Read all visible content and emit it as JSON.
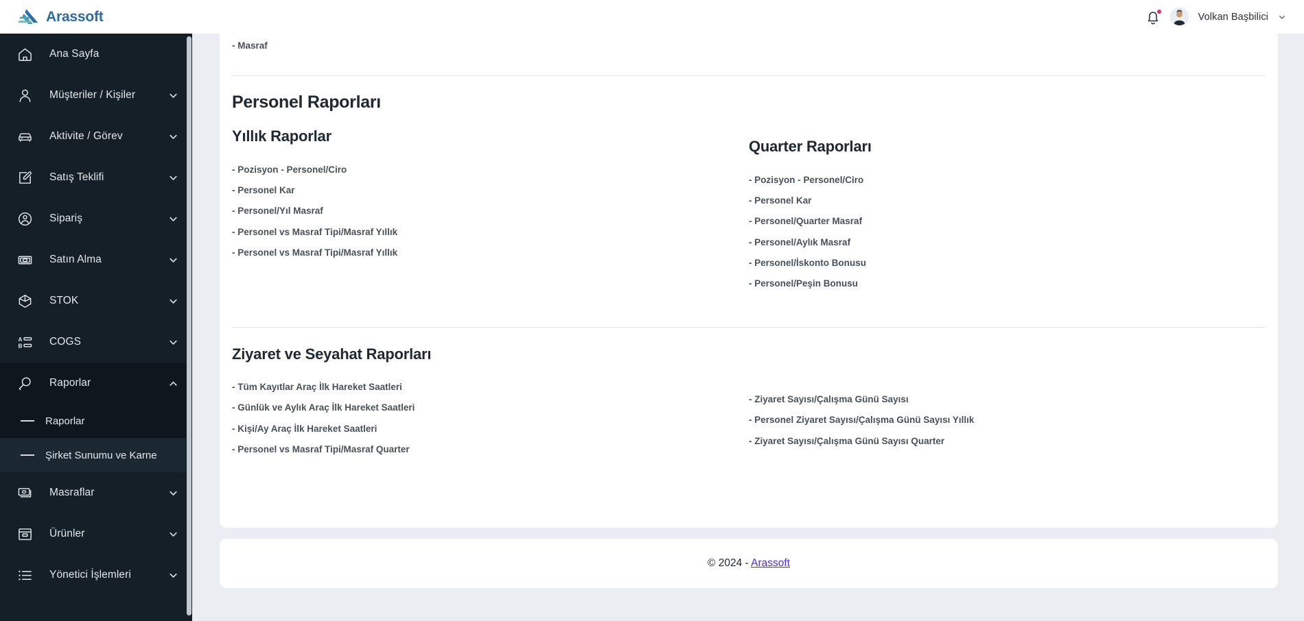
{
  "brand": {
    "name": "Arassoft",
    "logo_icon": "arassoft-logo-icon"
  },
  "header": {
    "notification_icon": "bell-icon",
    "has_notification_dot": true,
    "avatar_icon": "user-avatar",
    "user_name": "Volkan Başbilici",
    "chevron_icon": "chevron-down-icon"
  },
  "sidebar": {
    "items": [
      {
        "label": "Ana Sayfa",
        "icon": "home-icon",
        "expandable": false
      },
      {
        "label": "Müşteriler / Kişiler",
        "icon": "person-icon",
        "expandable": true,
        "chevron": "chevron-down-icon"
      },
      {
        "label": "Aktivite / Görev",
        "icon": "car-icon",
        "expandable": true,
        "chevron": "chevron-down-icon"
      },
      {
        "label": "Satış Teklifi",
        "icon": "edit-document-icon",
        "expandable": true,
        "chevron": "chevron-down-icon"
      },
      {
        "label": "Sipariş",
        "icon": "user-circle-icon",
        "expandable": true,
        "chevron": "chevron-down-icon"
      },
      {
        "label": "Satın Alma",
        "icon": "banknote-icon",
        "expandable": true,
        "chevron": "chevron-down-icon"
      },
      {
        "label": "STOK",
        "icon": "cube-icon",
        "expandable": true,
        "chevron": "chevron-down-icon"
      },
      {
        "label": "COGS",
        "icon": "list-ab-icon",
        "expandable": true,
        "chevron": "chevron-down-icon"
      },
      {
        "label": "Raporlar",
        "icon": "magnifier-icon",
        "expandable": true,
        "chevron": "chevron-up-icon",
        "expanded": true
      },
      {
        "label": "Masraflar",
        "icon": "money-stack-icon",
        "expandable": true,
        "chevron": "chevron-down-icon"
      },
      {
        "label": "Ürünler",
        "icon": "box-icon",
        "expandable": true,
        "chevron": "chevron-down-icon"
      },
      {
        "label": "Yönetici İşlemleri",
        "icon": "bullet-list-icon",
        "expandable": true,
        "chevron": "chevron-down-icon"
      }
    ],
    "sub_items": [
      {
        "label": "Raporlar",
        "highlighted": false
      },
      {
        "label": "Şirket Sunumu ve Karne",
        "highlighted": true
      }
    ],
    "scrollbar": {
      "name": "sidebar-scrollbar"
    }
  },
  "main": {
    "orphan_item": "- Masraf",
    "sections": [
      {
        "title": "Personel Raporları",
        "left": {
          "subtitle": "Yıllık Raporlar",
          "items": [
            "- Pozisyon - Personel/Ciro",
            "- Personel Kar",
            "- Personel/Yıl Masraf",
            "- Personel vs Masraf Tipi/Masraf Yıllık",
            "- Personel vs Masraf Tipi/Masraf Yıllık"
          ]
        },
        "right": {
          "subtitle": "Quarter Raporları",
          "items": [
            "- Pozisyon - Personel/Ciro",
            "- Personel Kar",
            "- Personel/Quarter Masraf",
            "- Personel/Aylık Masraf",
            "- Personel/İskonto Bonusu",
            "- Personel/Peşin Bonusu"
          ]
        }
      },
      {
        "title": "Ziyaret ve Seyahat Raporları",
        "left": {
          "subtitle": "",
          "items": [
            "- Tüm Kayıtlar Araç İlk Hareket Saatleri",
            "- Günlük ve Aylık Araç İlk Hareket Saatleri",
            "- Kişi/Ay Araç İlk Hareket Saatleri",
            "- Personel vs Masraf Tipi/Masraf Quarter"
          ]
        },
        "right": {
          "subtitle": "",
          "items": [
            "- Ziyaret Sayısı/Çalışma Günü Sayısı",
            "- Personel Ziyaret Sayısı/Çalışma Günü Sayısı Yıllık",
            "- Ziyaret Sayısı/Çalışma Günü Sayısı Quarter"
          ]
        }
      }
    ]
  },
  "footer": {
    "copyright": "© 2024 - ",
    "link_label": "Arassoft"
  },
  "colors": {
    "sidebar_bg": "#151f27",
    "sidebar_active_bg": "#0f171d",
    "sidebar_highlight_bg": "#1b2832",
    "brand_blue": "#2b6ca3",
    "page_bg": "#eaedf1",
    "text_dark": "#202830",
    "text_muted": "#4a5058",
    "footer_link": "#4b2fd6",
    "notification_dot": "#f0266d"
  }
}
